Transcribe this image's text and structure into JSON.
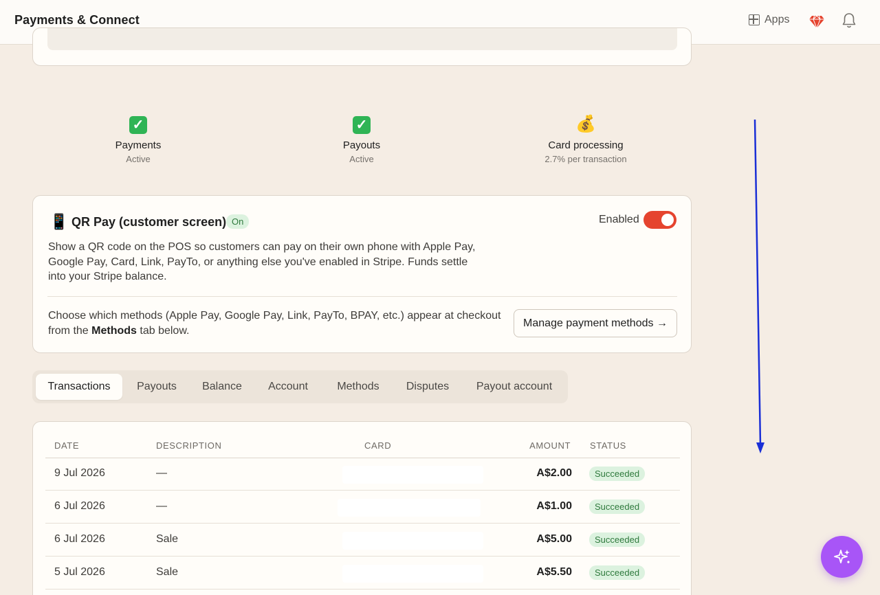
{
  "header": {
    "title": "Payments & Connect",
    "apps_label": "Apps"
  },
  "stats": [
    {
      "icon": "check-mark-icon",
      "label": "Payments",
      "sub": "Active"
    },
    {
      "icon": "check-mark-icon",
      "label": "Payouts",
      "sub": "Active"
    },
    {
      "icon": "money-bag-icon",
      "label": "Card processing",
      "sub": "2.7% per transaction"
    }
  ],
  "qr_pay": {
    "title": "QR Pay (customer screen)",
    "badge": "On",
    "enabled_label": "Enabled",
    "toggle_on": true,
    "description": "Show a QR code on the POS so customers can pay on their own phone with Apple Pay, Google Pay, Card, Link, PayTo, or anything else you've enabled in Stripe. Funds settle into your Stripe balance.",
    "choose_prefix": "Choose which methods (Apple Pay, Google Pay, Link, PayTo, BPAY, etc.) appear at checkout from the",
    "choose_bold": "Methods",
    "choose_suffix": "tab below.",
    "manage_button": "Manage payment methods →"
  },
  "tabs": [
    "Transactions",
    "Payouts",
    "Balance",
    "Account",
    "Methods",
    "Disputes",
    "Payout account"
  ],
  "active_tab": "Transactions",
  "transactions": {
    "columns": [
      "DATE",
      "DESCRIPTION",
      "CARD",
      "AMOUNT",
      "STATUS"
    ],
    "rows": [
      {
        "date": "9 Jul 2026",
        "description": "—",
        "amount": "A$2.00",
        "status": "Succeeded"
      },
      {
        "date": "6 Jul 2026",
        "description": "—",
        "amount": "A$1.00",
        "status": "Succeeded"
      },
      {
        "date": "6 Jul 2026",
        "description": "Sale",
        "amount": "A$5.00",
        "status": "Succeeded"
      },
      {
        "date": "5 Jul 2026",
        "description": "Sale",
        "amount": "A$5.50",
        "status": "Succeeded"
      }
    ]
  },
  "colors": {
    "background": "#f5ede4",
    "toggle_on": "#e5442f",
    "success_badge_bg": "#dcf2df",
    "success_badge_text": "#2f7a3d",
    "fab": "#a855f7",
    "annotation_arrow": "#1a2fd6"
  },
  "icons": {
    "apps": "grid-icon",
    "gem": "gem-icon",
    "notifications": "bell-icon",
    "qr_pay": "mobile-phone-icon",
    "assistant": "sparkles-icon"
  }
}
